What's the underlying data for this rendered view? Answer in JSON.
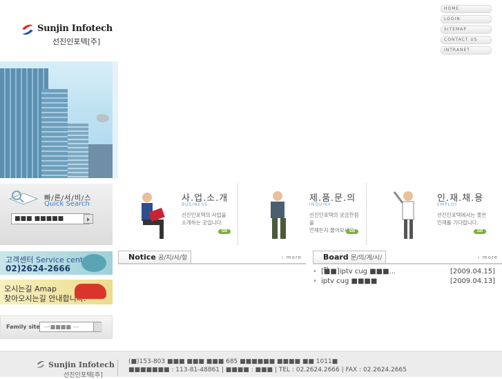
{
  "topnav": [
    "HOME",
    "LOGIN",
    "SITEMAP",
    "CONTACT US",
    "INTRANET"
  ],
  "logo": {
    "brand": "Sunjin Infotech",
    "korean": "선진인포텍[주]"
  },
  "quick_search": {
    "title_kr": "빠/른/서/비/스",
    "title_en": "Quick Search",
    "input_value": "■■■ ■■■■■"
  },
  "cards": [
    {
      "title": "사.업.소.개",
      "subtitle": "BUSINESS",
      "desc": "선진인포텍의 사업을\n소개하는 곳입니다.",
      "go": "GO"
    },
    {
      "title": "제.품.문.의",
      "subtitle": "INQUIRY",
      "desc": "선진인포텍의 궁금한점을\n언제든지 물어보세요.",
      "go": "GO"
    },
    {
      "title": "인.재.채.용",
      "subtitle": "EMPLOY",
      "desc": "선진인포텍에서는 좋은\n인재를 기다립니다.",
      "go": "GO"
    }
  ],
  "service": {
    "line1": "고객센터 Service center",
    "line2": "02)2624-2666"
  },
  "amap": {
    "line1": "오시는길 Amap",
    "line2": "찾아오시는길 안내합니다."
  },
  "family": {
    "label": "Family site",
    "value": "---■■■■ ---"
  },
  "notice": {
    "title_en": "Notice",
    "title_kr": "공/지/사/항",
    "more": "› more"
  },
  "board": {
    "title_en": "Board",
    "title_kr": "문/의/게/시/판",
    "more": "› more",
    "rows": [
      {
        "title": "[■■]iptv cug ■■■...",
        "date": "[2009.04.15]"
      },
      {
        "title": "iptv cug ■■■■",
        "date": "[2009.04.13]"
      }
    ]
  },
  "footer": {
    "brand": "Sunjin Infotech",
    "korean": "선진인포텍[주]",
    "addr1": "(■)153-803 ■■■ ■■■ ■■■ 685 ■■■■■■ ■■■■ ■■ 1011■",
    "addr2": "■■■■■■■ : 113-81-48861  |  ■■■■ : ■■■  |  TEL : 02.2624.2666  |  FAX : 02.2624.2665"
  },
  "colors": {
    "accent_blue": "#3a7cc4",
    "go_green": "#7ab23a",
    "footer_bg": "#ececec"
  }
}
